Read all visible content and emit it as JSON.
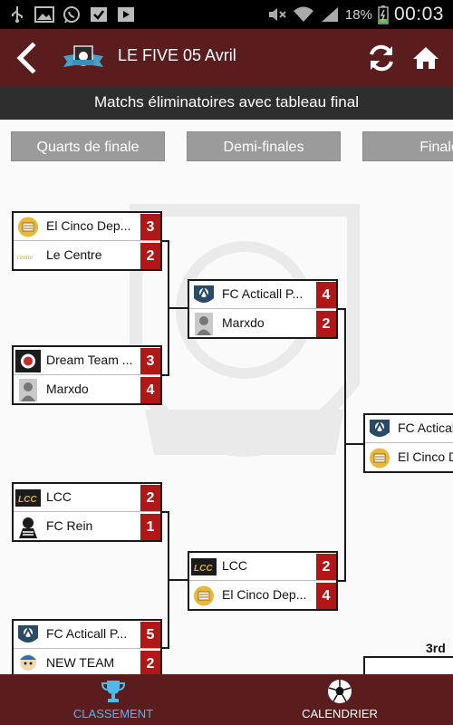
{
  "status_bar": {
    "icons": [
      "usb-icon",
      "image-icon",
      "whatsapp-icon",
      "checkbox-icon",
      "play-store-icon",
      "mute-icon",
      "wifi-icon",
      "signal-icon",
      "battery-icon"
    ],
    "battery": "18%",
    "time": "00:03"
  },
  "app_bar": {
    "title": "LE FIVE 05 Avril"
  },
  "subheader": {
    "title": "Matchs éliminatoires avec tableau final"
  },
  "rounds": [
    "Quarts de finale",
    "Demi-finales",
    "Finale"
  ],
  "quarterfinals": [
    {
      "team1": "El Cinco Dep...",
      "score1": "3",
      "team2": "Le Centre",
      "score2": "2"
    },
    {
      "team1": "Dream Team ...",
      "score1": "3",
      "team2": "Marxdo",
      "score2": "4"
    },
    {
      "team1": "LCC",
      "score1": "2",
      "team2": "FC Rein",
      "score2": "1"
    },
    {
      "team1": "FC Acticall P...",
      "score1": "5",
      "team2": "NEW TEAM",
      "score2": "2"
    }
  ],
  "semifinals": [
    {
      "team1": "FC Acticall P...",
      "score1": "4",
      "team2": "Marxdo",
      "score2": "2"
    },
    {
      "team1": "LCC",
      "score1": "2",
      "team2": "El Cinco Dep...",
      "score2": "4"
    }
  ],
  "final": {
    "team1": "FC Actical",
    "team2": "El Cinco D"
  },
  "third_place_label": "3rd",
  "bottom_nav": {
    "classement": "CLASSEMENT",
    "calendrier": "CALENDRIER"
  },
  "colors": {
    "app_bar": "#5a1c1d",
    "subheader": "#2e2e2e",
    "score_badge": "#b01818",
    "active_tab": "#4fb9ea",
    "round_header": "#9b9b9b"
  }
}
